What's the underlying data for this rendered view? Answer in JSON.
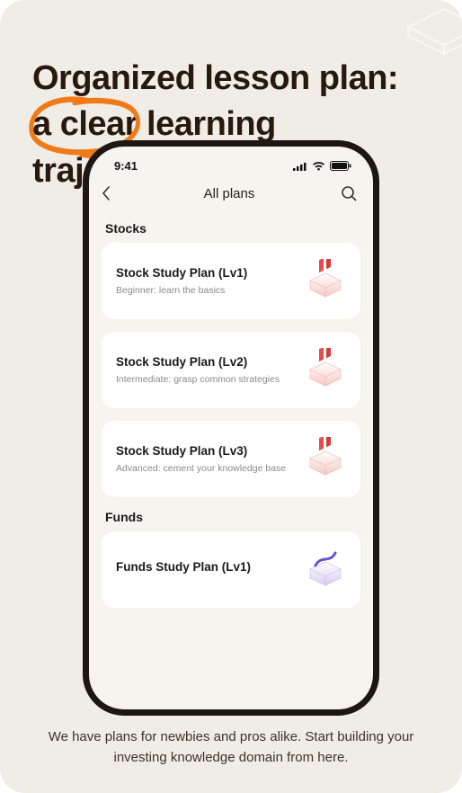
{
  "headline_part1": "Organized lesson plan: ",
  "headline_highlight": "a clear",
  "headline_part2": " learning trajectory",
  "subtext": "We have plans for newbies and pros alike. Start building your investing knowledge domain from here.",
  "phone": {
    "status_time": "9:41",
    "nav": {
      "title": "All plans"
    },
    "sections": [
      {
        "label": "Stocks",
        "cards": [
          {
            "title": "Stock Study Plan (Lv1)",
            "desc": "Beginner: learn the basics",
            "illus": "red"
          },
          {
            "title": "Stock Study Plan (Lv2)",
            "desc": "Intermediate: grasp common strategies",
            "illus": "red"
          },
          {
            "title": "Stock Study Plan (Lv3)",
            "desc": "Advanced: cement your knowledge base",
            "illus": "red"
          }
        ]
      },
      {
        "label": "Funds",
        "cards": [
          {
            "title": "Funds Study Plan (Lv1)",
            "desc": "",
            "illus": "purple"
          }
        ]
      }
    ]
  }
}
